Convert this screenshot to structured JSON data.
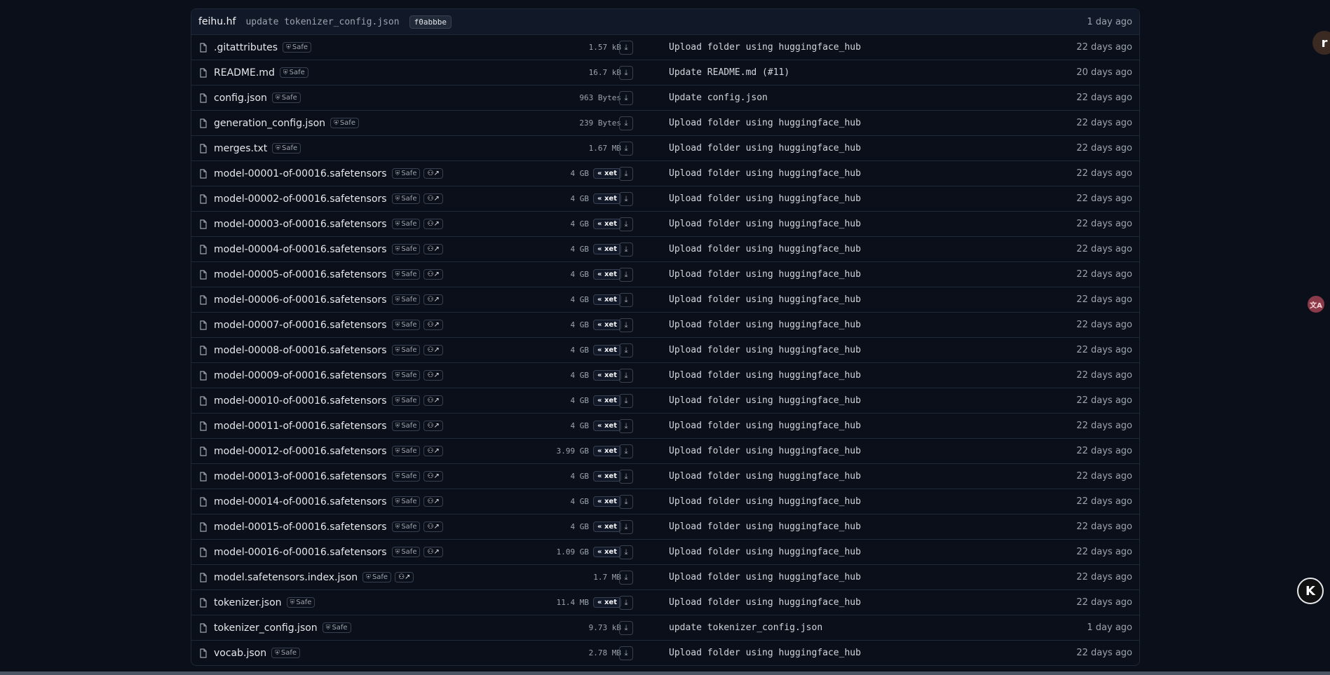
{
  "header": {
    "author": "feihu.hf",
    "message": "update tokenizer_config.json",
    "hash": "f0abbbe",
    "date": "1 day ago"
  },
  "safe_label": "Safe",
  "xet_label": "xet",
  "files": [
    {
      "name": ".gitattributes",
      "safe": true,
      "lfs": false,
      "size": "1.57 kB",
      "xet": false,
      "commit": "Upload folder using huggingface_hub",
      "date": "22 days ago"
    },
    {
      "name": "README.md",
      "safe": true,
      "lfs": false,
      "size": "16.7 kB",
      "xet": false,
      "commit": "Update README.md (#11)",
      "date": "20 days ago"
    },
    {
      "name": "config.json",
      "safe": true,
      "lfs": false,
      "size": "963 Bytes",
      "xet": false,
      "commit": "Update config.json",
      "date": "22 days ago"
    },
    {
      "name": "generation_config.json",
      "safe": true,
      "lfs": false,
      "size": "239 Bytes",
      "xet": false,
      "commit": "Upload folder using huggingface_hub",
      "date": "22 days ago"
    },
    {
      "name": "merges.txt",
      "safe": true,
      "lfs": false,
      "size": "1.67 MB",
      "xet": false,
      "commit": "Upload folder using huggingface_hub",
      "date": "22 days ago"
    },
    {
      "name": "model-00001-of-00016.safetensors",
      "safe": true,
      "lfs": true,
      "size": "4 GB",
      "xet": true,
      "commit": "Upload folder using huggingface_hub",
      "date": "22 days ago"
    },
    {
      "name": "model-00002-of-00016.safetensors",
      "safe": true,
      "lfs": true,
      "size": "4 GB",
      "xet": true,
      "commit": "Upload folder using huggingface_hub",
      "date": "22 days ago"
    },
    {
      "name": "model-00003-of-00016.safetensors",
      "safe": true,
      "lfs": true,
      "size": "4 GB",
      "xet": true,
      "commit": "Upload folder using huggingface_hub",
      "date": "22 days ago"
    },
    {
      "name": "model-00004-of-00016.safetensors",
      "safe": true,
      "lfs": true,
      "size": "4 GB",
      "xet": true,
      "commit": "Upload folder using huggingface_hub",
      "date": "22 days ago"
    },
    {
      "name": "model-00005-of-00016.safetensors",
      "safe": true,
      "lfs": true,
      "size": "4 GB",
      "xet": true,
      "commit": "Upload folder using huggingface_hub",
      "date": "22 days ago"
    },
    {
      "name": "model-00006-of-00016.safetensors",
      "safe": true,
      "lfs": true,
      "size": "4 GB",
      "xet": true,
      "commit": "Upload folder using huggingface_hub",
      "date": "22 days ago"
    },
    {
      "name": "model-00007-of-00016.safetensors",
      "safe": true,
      "lfs": true,
      "size": "4 GB",
      "xet": true,
      "commit": "Upload folder using huggingface_hub",
      "date": "22 days ago"
    },
    {
      "name": "model-00008-of-00016.safetensors",
      "safe": true,
      "lfs": true,
      "size": "4 GB",
      "xet": true,
      "commit": "Upload folder using huggingface_hub",
      "date": "22 days ago"
    },
    {
      "name": "model-00009-of-00016.safetensors",
      "safe": true,
      "lfs": true,
      "size": "4 GB",
      "xet": true,
      "commit": "Upload folder using huggingface_hub",
      "date": "22 days ago"
    },
    {
      "name": "model-00010-of-00016.safetensors",
      "safe": true,
      "lfs": true,
      "size": "4 GB",
      "xet": true,
      "commit": "Upload folder using huggingface_hub",
      "date": "22 days ago"
    },
    {
      "name": "model-00011-of-00016.safetensors",
      "safe": true,
      "lfs": true,
      "size": "4 GB",
      "xet": true,
      "commit": "Upload folder using huggingface_hub",
      "date": "22 days ago"
    },
    {
      "name": "model-00012-of-00016.safetensors",
      "safe": true,
      "lfs": true,
      "size": "3.99 GB",
      "xet": true,
      "commit": "Upload folder using huggingface_hub",
      "date": "22 days ago"
    },
    {
      "name": "model-00013-of-00016.safetensors",
      "safe": true,
      "lfs": true,
      "size": "4 GB",
      "xet": true,
      "commit": "Upload folder using huggingface_hub",
      "date": "22 days ago"
    },
    {
      "name": "model-00014-of-00016.safetensors",
      "safe": true,
      "lfs": true,
      "size": "4 GB",
      "xet": true,
      "commit": "Upload folder using huggingface_hub",
      "date": "22 days ago"
    },
    {
      "name": "model-00015-of-00016.safetensors",
      "safe": true,
      "lfs": true,
      "size": "4 GB",
      "xet": true,
      "commit": "Upload folder using huggingface_hub",
      "date": "22 days ago"
    },
    {
      "name": "model-00016-of-00016.safetensors",
      "safe": true,
      "lfs": true,
      "size": "1.09 GB",
      "xet": true,
      "commit": "Upload folder using huggingface_hub",
      "date": "22 days ago"
    },
    {
      "name": "model.safetensors.index.json",
      "safe": true,
      "lfs": true,
      "size": "1.7 MB",
      "xet": false,
      "commit": "Upload folder using huggingface_hub",
      "date": "22 days ago"
    },
    {
      "name": "tokenizer.json",
      "safe": true,
      "lfs": false,
      "size": "11.4 MB",
      "xet": true,
      "commit": "Upload folder using huggingface_hub",
      "date": "22 days ago"
    },
    {
      "name": "tokenizer_config.json",
      "safe": true,
      "lfs": false,
      "size": "9.73 kB",
      "xet": false,
      "commit": "update tokenizer_config.json",
      "date": "1 day ago"
    },
    {
      "name": "vocab.json",
      "safe": true,
      "lfs": false,
      "size": "2.78 MB",
      "xet": false,
      "commit": "Upload folder using huggingface_hub",
      "date": "22 days ago"
    }
  ],
  "floating": {
    "top_right": "r",
    "middle_right": "文A",
    "bottom_right": "K"
  }
}
